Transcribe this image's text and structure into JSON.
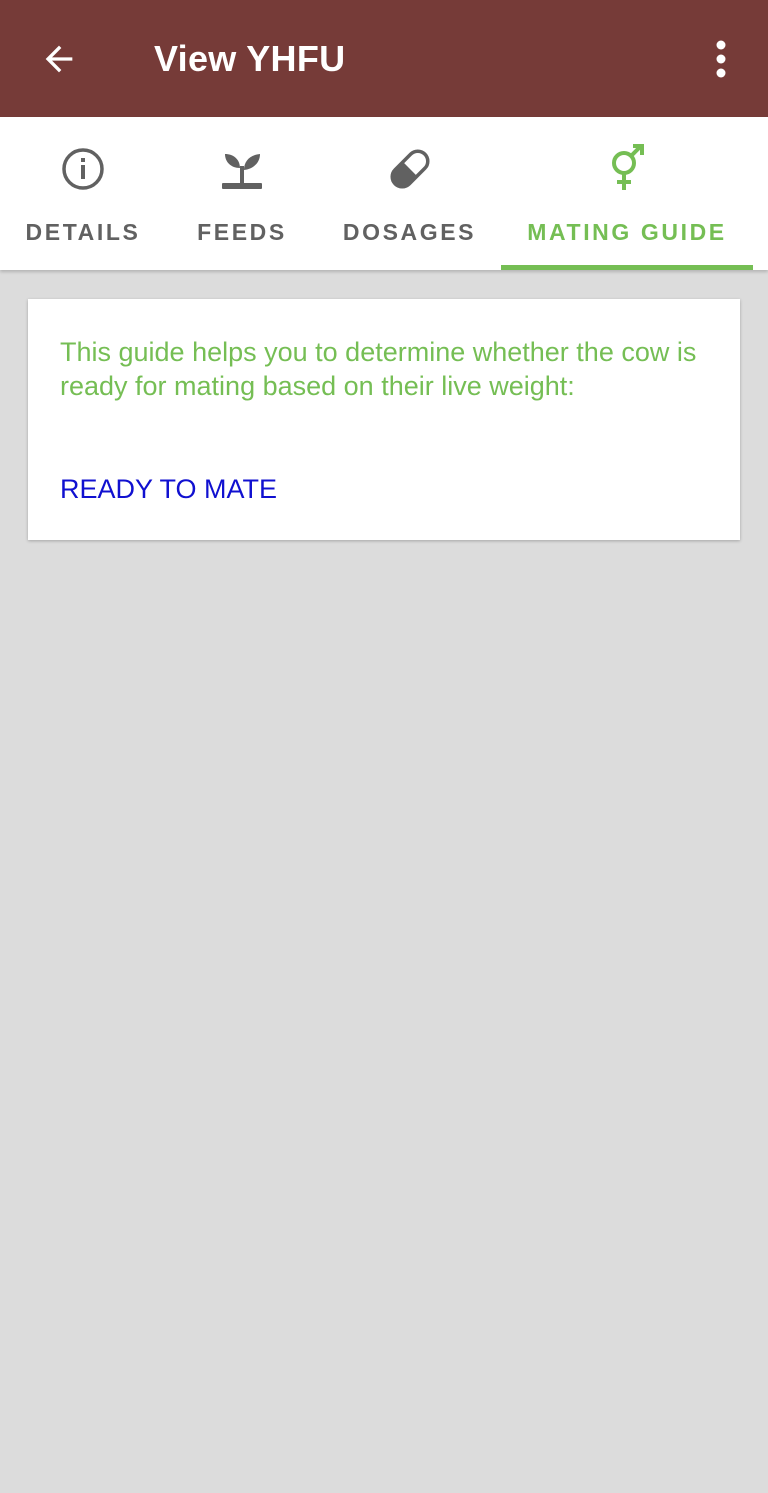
{
  "appbar": {
    "title": "View YHFU",
    "background": "#763b38",
    "back_icon": "arrow-left-icon",
    "more_icon": "more-vertical-icon"
  },
  "tabs": [
    {
      "label": "DETAILS",
      "icon": "info-circle-icon",
      "active": false
    },
    {
      "label": "FEEDS",
      "icon": "sprout-icon",
      "active": false
    },
    {
      "label": "DOSAGES",
      "icon": "pill-icon",
      "active": false
    },
    {
      "label": "MATING GUIDE",
      "icon": "gender-symbol-icon",
      "active": true
    }
  ],
  "colors": {
    "accent": "#75be54",
    "tab_inactive": "#616161",
    "link": "#1010d0",
    "page_background": "#dcdcdc"
  },
  "card": {
    "guide_text": "This guide helps you to determine whether the cow is ready for mating based on their live weight:",
    "status_link": "READY TO MATE"
  }
}
